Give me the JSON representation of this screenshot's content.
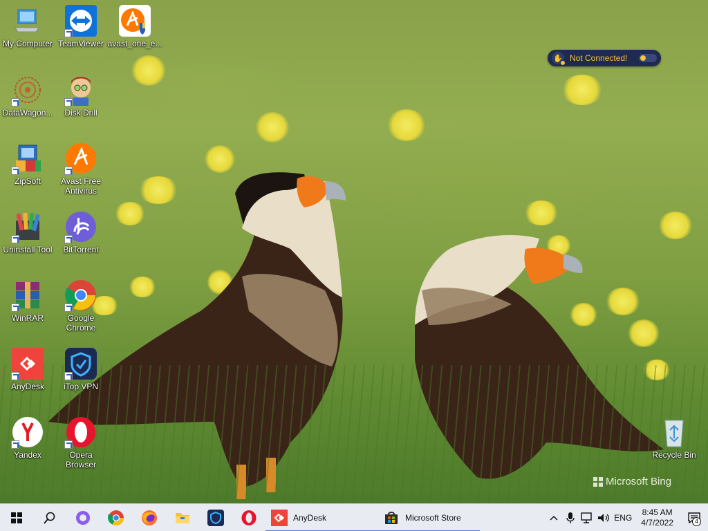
{
  "desktop": {
    "icons": [
      {
        "label": "My Computer"
      },
      {
        "label": "TeamViewer"
      },
      {
        "label": "avast_one_e..."
      },
      {
        "label": "DataWagon..."
      },
      {
        "label": "Disk Drill"
      },
      {
        "label": "ZipSoft"
      },
      {
        "label": "Avast Free\nAntivirus"
      },
      {
        "label": "Uninstall Tool"
      },
      {
        "label": "BitTorrent"
      },
      {
        "label": "WinRAR"
      },
      {
        "label": "Google\nChrome"
      },
      {
        "label": "AnyDesk"
      },
      {
        "label": "iTop VPN"
      },
      {
        "label": "Yandex"
      },
      {
        "label": "Opera\nBrowser"
      },
      {
        "label": "Recycle Bin"
      }
    ],
    "watermark": "Microsoft Bing"
  },
  "vpn_widget": {
    "status": "Not Connected!",
    "accent": "#f2c53d"
  },
  "taskbar": {
    "apps": [
      {
        "label": "AnyDesk"
      },
      {
        "label": "Microsoft Store"
      }
    ],
    "tray": {
      "language": "ENG",
      "time": "8:45 AM",
      "date": "4/7/2022",
      "notifications": "4"
    }
  }
}
